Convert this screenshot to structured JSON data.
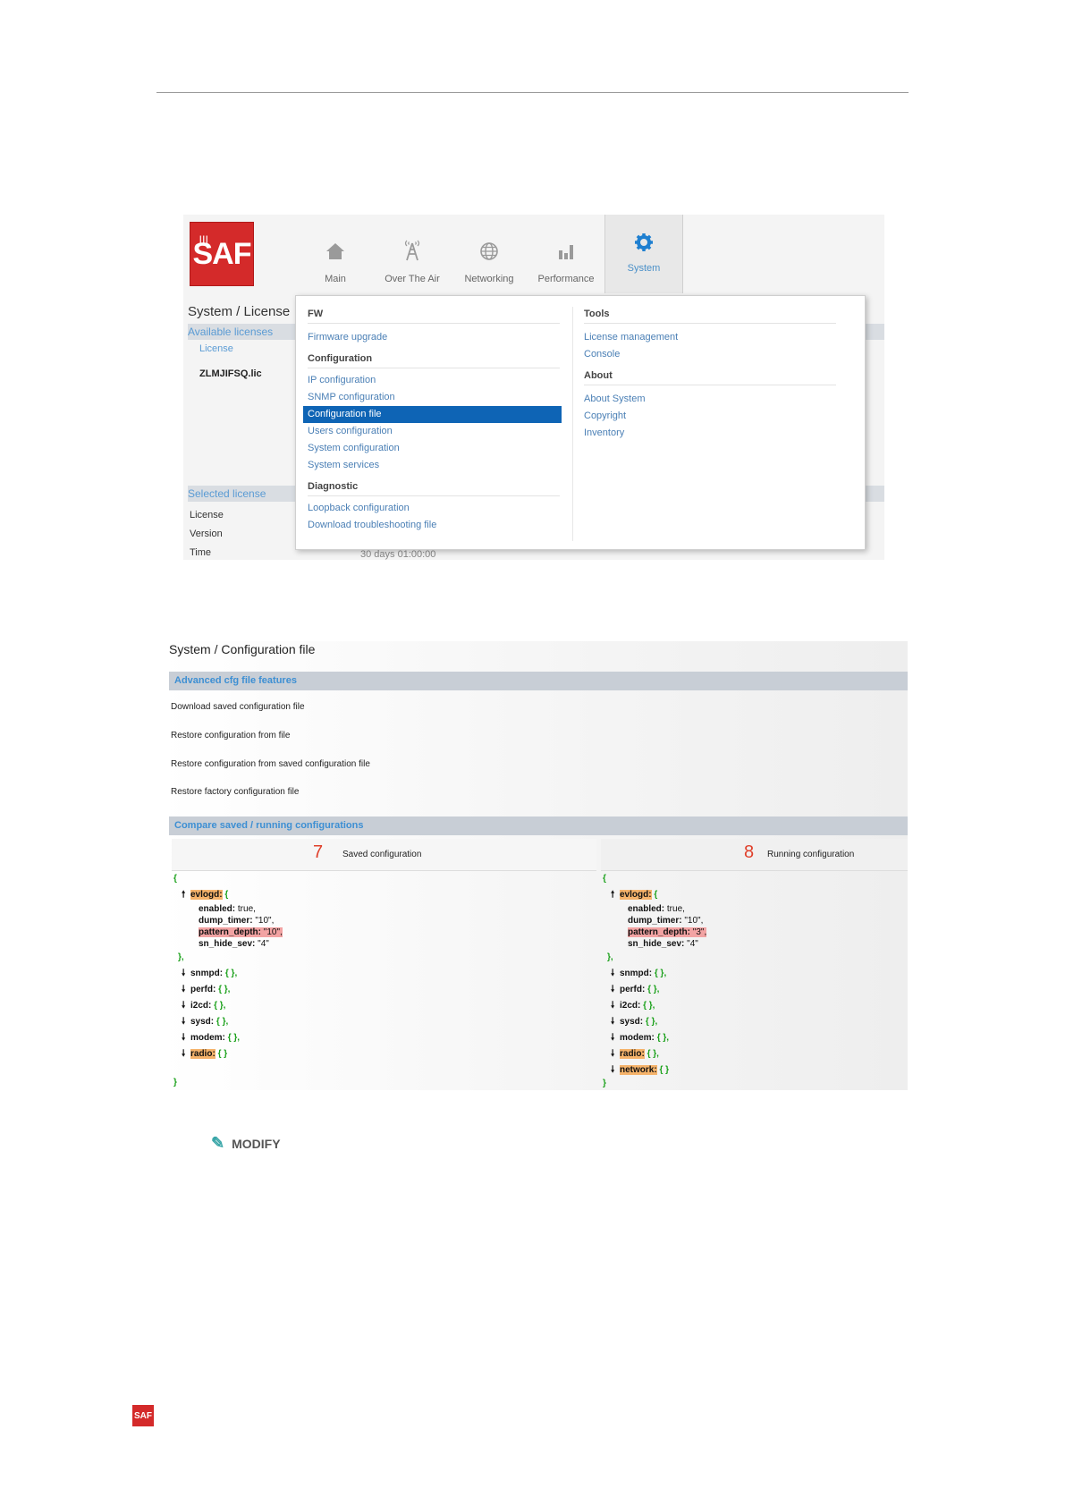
{
  "logo_text": "SAF",
  "nav": [
    {
      "label": "Main",
      "icon": "home-icon"
    },
    {
      "label": "Over The Air",
      "icon": "antenna-icon"
    },
    {
      "label": "Networking",
      "icon": "globe-icon"
    },
    {
      "label": "Performance",
      "icon": "bar-chart-icon"
    },
    {
      "label": "System",
      "icon": "gear-icon",
      "active": true
    }
  ],
  "license_page": {
    "title": "System / License",
    "available_header": "Available licenses",
    "license_col": "License",
    "license_file": "ZLMJIFSQ.lic",
    "selected_header": "Selected license",
    "rows": [
      "License",
      "Version",
      "Time"
    ],
    "time_value": "30 days 01:00:00"
  },
  "menu": {
    "left": {
      "fw_header": "FW",
      "fw_items": [
        "Firmware upgrade"
      ],
      "config_header": "Configuration",
      "config_items": [
        "IP configuration",
        "SNMP configuration",
        "Configuration file",
        "Users configuration",
        "System configuration",
        "System services"
      ],
      "selected": "Configuration file",
      "diag_header": "Diagnostic",
      "diag_items": [
        "Loopback configuration",
        "Download troubleshooting file"
      ]
    },
    "right": {
      "tools_header": "Tools",
      "tools_items": [
        "License management",
        "Console"
      ],
      "about_header": "About",
      "about_items": [
        "About System",
        "Copyright",
        "Inventory"
      ]
    }
  },
  "config_page": {
    "title": "System / Configuration file",
    "advanced_header": "Advanced cfg file features",
    "actions": [
      "Download saved configuration file",
      "Restore configuration from file",
      "Restore configuration from saved configuration file",
      "Restore factory configuration file"
    ],
    "compare_header": "Compare saved / running configurations",
    "saved": {
      "number": "7",
      "title": "Saved configuration",
      "evlogd_key": "evlogd:",
      "fields": [
        {
          "key": "enabled:",
          "value": "true,"
        },
        {
          "key": "dump_timer:",
          "value": "\"10\","
        },
        {
          "key": "pattern_depth:",
          "value": "\"10\",",
          "diff": true
        },
        {
          "key": "sn_hide_sev:",
          "value": "\"4\""
        }
      ],
      "collapsed": [
        "snmpd:",
        "perfd:",
        "i2cd:",
        "sysd:",
        "modem:"
      ],
      "diff_keys": [
        "radio:"
      ]
    },
    "running": {
      "number": "8",
      "title": "Running configuration",
      "evlogd_key": "evlogd:",
      "fields": [
        {
          "key": "enabled:",
          "value": "true,"
        },
        {
          "key": "dump_timer:",
          "value": "\"10\","
        },
        {
          "key": "pattern_depth:",
          "value": "\"3\",",
          "diff": true
        },
        {
          "key": "sn_hide_sev:",
          "value": "\"4\""
        }
      ],
      "collapsed": [
        "snmpd:",
        "perfd:",
        "i2cd:",
        "sysd:",
        "modem:"
      ],
      "diff_keys": [
        "radio:",
        "network:"
      ]
    },
    "empty_obj": "{ },",
    "empty_obj_last": "{ }",
    "open_brace": "{",
    "close_brace": "}",
    "close_obj": "},"
  },
  "modify_label": "MODIFY",
  "colors": {
    "accent": "#0e64b5",
    "link": "#4a7fb5",
    "brand_red": "#d42a2a",
    "diff_orange": "#f5b36b",
    "diff_red": "#f2a3a3",
    "number_red": "#e0402b"
  }
}
